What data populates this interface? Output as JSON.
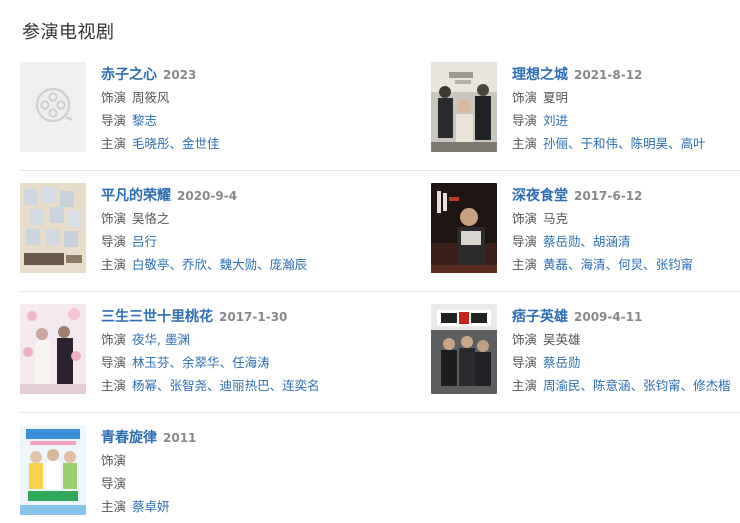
{
  "section_title": "参演电视剧",
  "labels": {
    "role": "饰演",
    "director": "导演",
    "starring": "主演"
  },
  "separator": "、",
  "shows": [
    {
      "title": "赤子之心",
      "date": "2023",
      "role": "周筱风",
      "role_link": false,
      "directors": [
        "黎志"
      ],
      "stars": [
        "毛晓彤",
        "金世佳"
      ],
      "poster": "placeholder"
    },
    {
      "title": "理想之城",
      "date": "2021-8-12",
      "role": "夏明",
      "role_link": false,
      "directors": [
        "刘进"
      ],
      "stars": [
        "孙俪",
        "于和伟",
        "陈明昊",
        "高叶"
      ],
      "poster": "lixiang"
    },
    {
      "title": "平凡的荣耀",
      "date": "2020-9-4",
      "role": "吴恪之",
      "role_link": false,
      "directors": [
        "吕行"
      ],
      "stars": [
        "白敬亭",
        "乔欣",
        "魏大勋",
        "庞瀚辰"
      ],
      "poster": "pingfan"
    },
    {
      "title": "深夜食堂",
      "date": "2017-6-12",
      "role": "马克",
      "role_link": false,
      "directors": [
        "蔡岳勋",
        "胡涵清"
      ],
      "stars": [
        "黄磊",
        "海清",
        "何炅",
        "张钧甯"
      ],
      "poster": "shenye"
    },
    {
      "title": "三生三世十里桃花",
      "date": "2017-1-30",
      "role": "夜华, 墨渊",
      "role_link": true,
      "directors": [
        "林玉芬",
        "余翠华",
        "任海涛"
      ],
      "stars": [
        "杨幂",
        "张智尧",
        "迪丽热巴",
        "连奕名"
      ],
      "poster": "sansheng"
    },
    {
      "title": "痞子英雄",
      "date": "2009-4-11",
      "role": "吴英雄",
      "role_link": false,
      "directors": [
        "蔡岳勋"
      ],
      "stars": [
        "周渝民",
        "陈意涵",
        "张钧甯",
        "修杰楷"
      ],
      "poster": "pizi"
    },
    {
      "title": "青春旋律",
      "date": "2011",
      "role": "",
      "role_link": false,
      "directors": [],
      "stars": [
        "蔡卓妍"
      ],
      "poster": "qingchun"
    }
  ]
}
